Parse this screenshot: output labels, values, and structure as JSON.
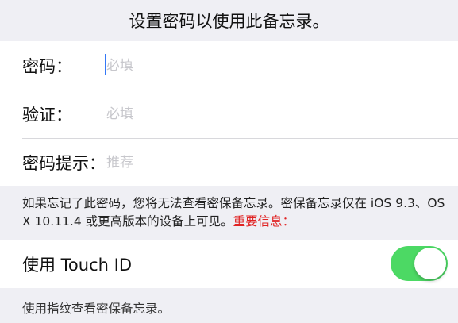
{
  "header": {
    "title": "设置密码以使用此备忘录。"
  },
  "form": {
    "password": {
      "label": "密码：",
      "placeholder": "必填",
      "value": ""
    },
    "verify": {
      "label": "验证：",
      "placeholder": "必填",
      "value": ""
    },
    "hint": {
      "label": "密码提示：",
      "placeholder": "推荐",
      "value": ""
    }
  },
  "notice": {
    "text": "如果忘记了此密码，您将无法查看密保备忘录。密保备忘录仅在 iOS 9.3、OS X 10.11.4 或更高版本的设备上可见。",
    "link": "重要信息："
  },
  "touch_id": {
    "label": "使用 Touch ID",
    "enabled": true,
    "accent_color": "#4cd964"
  },
  "footnote": {
    "text": "使用指纹查看密保备忘录。"
  }
}
